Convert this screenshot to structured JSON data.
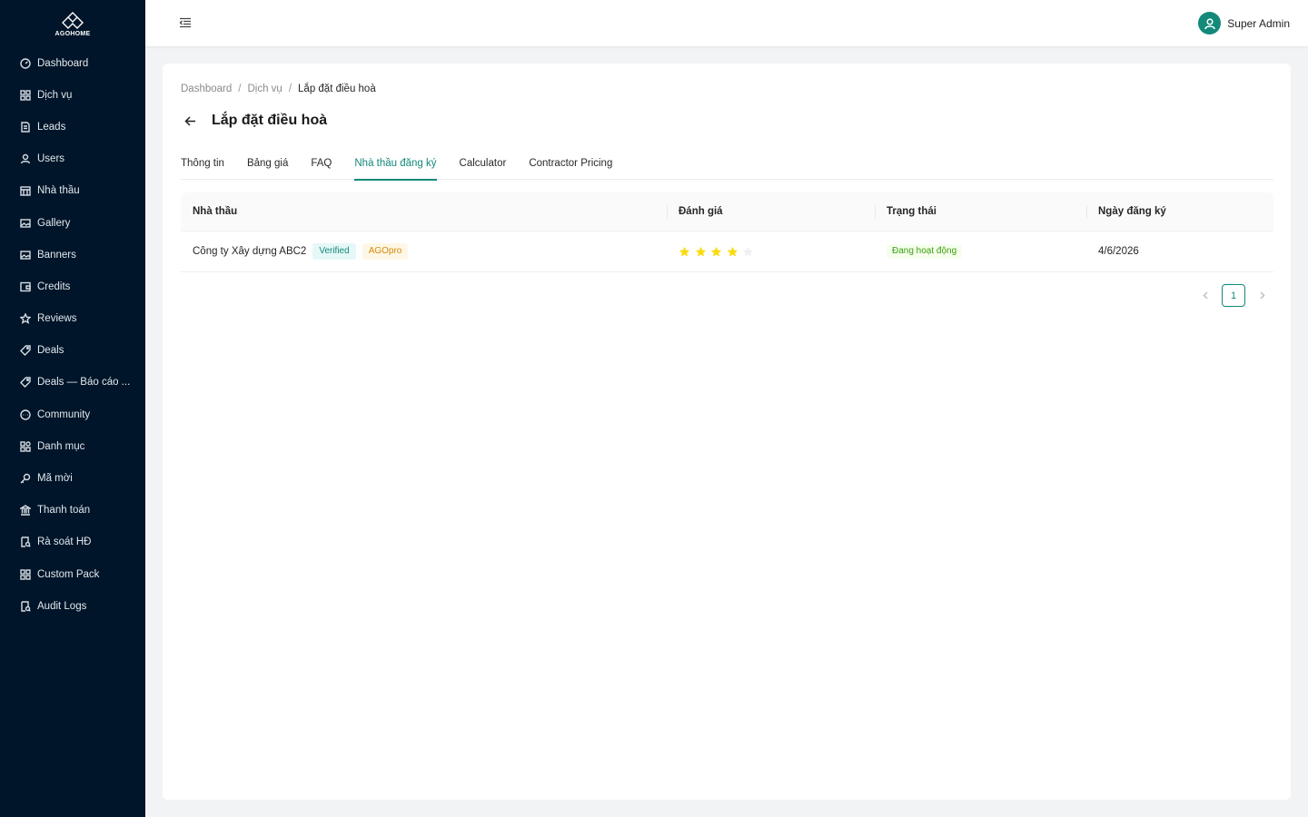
{
  "brand": {
    "logo_text": "AGOHOME"
  },
  "sidebar": {
    "items": [
      {
        "label": "Dashboard",
        "icon": "dashboard-icon"
      },
      {
        "label": "Dịch vụ",
        "icon": "grid-icon"
      },
      {
        "label": "Leads",
        "icon": "file-icon"
      },
      {
        "label": "Users",
        "icon": "user-icon"
      },
      {
        "label": "Nhà thầu",
        "icon": "building-icon"
      },
      {
        "label": "Gallery",
        "icon": "image-icon"
      },
      {
        "label": "Banners",
        "icon": "image-icon"
      },
      {
        "label": "Credits",
        "icon": "wallet-icon"
      },
      {
        "label": "Reviews",
        "icon": "star-icon"
      },
      {
        "label": "Deals",
        "icon": "tag-icon"
      },
      {
        "label": "Deals — Báo cáo ...",
        "icon": "tag-icon"
      },
      {
        "label": "Community",
        "icon": "message-icon"
      },
      {
        "label": "Danh mục",
        "icon": "apps-icon"
      },
      {
        "label": "Mã mời",
        "icon": "key-icon"
      },
      {
        "label": "Thanh toán",
        "icon": "bank-icon"
      },
      {
        "label": "Rà soát HĐ",
        "icon": "audit-icon"
      },
      {
        "label": "Custom Pack",
        "icon": "grid-icon"
      },
      {
        "label": "Audit Logs",
        "icon": "audit-icon"
      }
    ]
  },
  "header": {
    "user_name": "Super Admin"
  },
  "breadcrumb": {
    "items": [
      "Dashboard",
      "Dịch vụ",
      "Lắp đặt điều hoà"
    ],
    "separator": "/"
  },
  "page": {
    "title": "Lắp đặt điều hoà"
  },
  "tabs": [
    {
      "label": "Thông tin",
      "active": false
    },
    {
      "label": "Bảng giá",
      "active": false
    },
    {
      "label": "FAQ",
      "active": false
    },
    {
      "label": "Nhà thầu đăng ký",
      "active": true
    },
    {
      "label": "Calculator",
      "active": false
    },
    {
      "label": "Contractor Pricing",
      "active": false
    }
  ],
  "table": {
    "columns": [
      "Nhà thầu",
      "Đánh giá",
      "Trạng thái",
      "Ngày đăng ký"
    ],
    "rows": [
      {
        "contractor": "Công ty Xây dựng ABC2",
        "tags": [
          "Verified",
          "AGOpro"
        ],
        "rating": 4,
        "rating_max": 5,
        "status": "Đang hoạt động",
        "registered_date": "4/6/2026"
      }
    ]
  },
  "pagination": {
    "current_page": "1"
  },
  "colors": {
    "sidebar_bg": "#001529",
    "accent": "#13897a",
    "star_filled": "#fadb14",
    "star_empty": "#f0f0f0"
  }
}
